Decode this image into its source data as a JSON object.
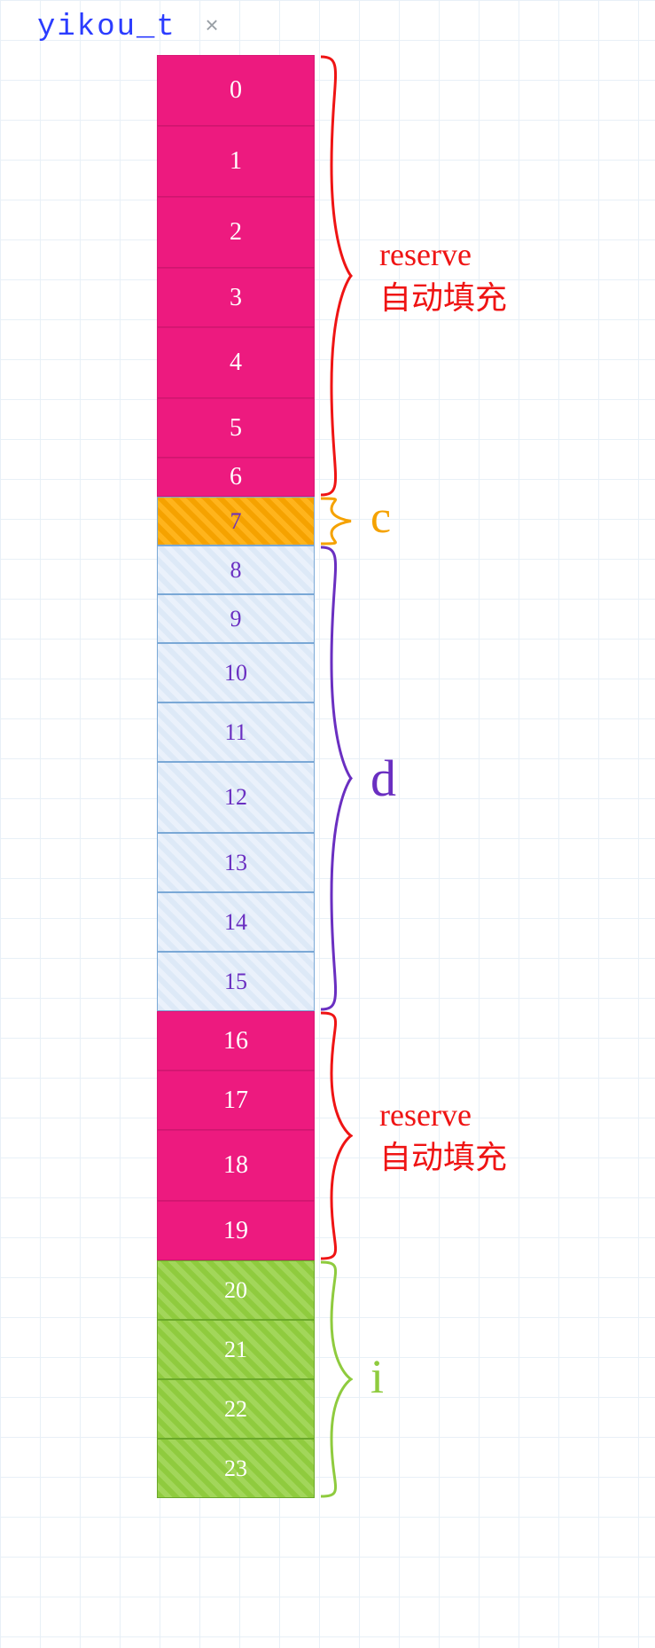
{
  "title": {
    "text": "yikou_t",
    "close_glyph": "×"
  },
  "segments": [
    {
      "name": "reserve1",
      "kind": "reserve",
      "label_lines": [
        "reserve",
        "自动填充"
      ],
      "cells": [
        {
          "idx": "0",
          "h": "h-big"
        },
        {
          "idx": "1",
          "h": "h-big"
        },
        {
          "idx": "2",
          "h": "h-big"
        },
        {
          "idx": "3",
          "h": "h-mid"
        },
        {
          "idx": "4",
          "h": "h-big"
        },
        {
          "idx": "5",
          "h": "h-mid"
        },
        {
          "idx": "6",
          "h": "h-xs"
        }
      ]
    },
    {
      "name": "c",
      "kind": "c",
      "label": "c",
      "cells": [
        {
          "idx": "7",
          "h": "h-sm"
        }
      ]
    },
    {
      "name": "d",
      "kind": "d",
      "label": "d",
      "cells": [
        {
          "idx": "8",
          "h": "h-sm"
        },
        {
          "idx": "9",
          "h": "h-sm"
        },
        {
          "idx": "10",
          "h": "h-mid"
        },
        {
          "idx": "11",
          "h": "h-mid"
        },
        {
          "idx": "12",
          "h": "h-big"
        },
        {
          "idx": "13",
          "h": "h-mid"
        },
        {
          "idx": "14",
          "h": "h-mid"
        },
        {
          "idx": "15",
          "h": "h-mid"
        }
      ]
    },
    {
      "name": "reserve2",
      "kind": "reserve",
      "label_lines": [
        "reserve",
        "自动填充"
      ],
      "cells": [
        {
          "idx": "16",
          "h": "h-mid"
        },
        {
          "idx": "17",
          "h": "h-mid"
        },
        {
          "idx": "18",
          "h": "h-big"
        },
        {
          "idx": "19",
          "h": "h-mid"
        }
      ]
    },
    {
      "name": "i",
      "kind": "i",
      "label": "i",
      "cells": [
        {
          "idx": "20",
          "h": "h-mid"
        },
        {
          "idx": "21",
          "h": "h-mid"
        },
        {
          "idx": "22",
          "h": "h-mid"
        },
        {
          "idx": "23",
          "h": "h-mid"
        }
      ]
    }
  ],
  "brace_colors": {
    "reserve": "#ef1414",
    "c": "#f5a200",
    "d": "#6a2fc1",
    "i": "#8fcb3e"
  }
}
